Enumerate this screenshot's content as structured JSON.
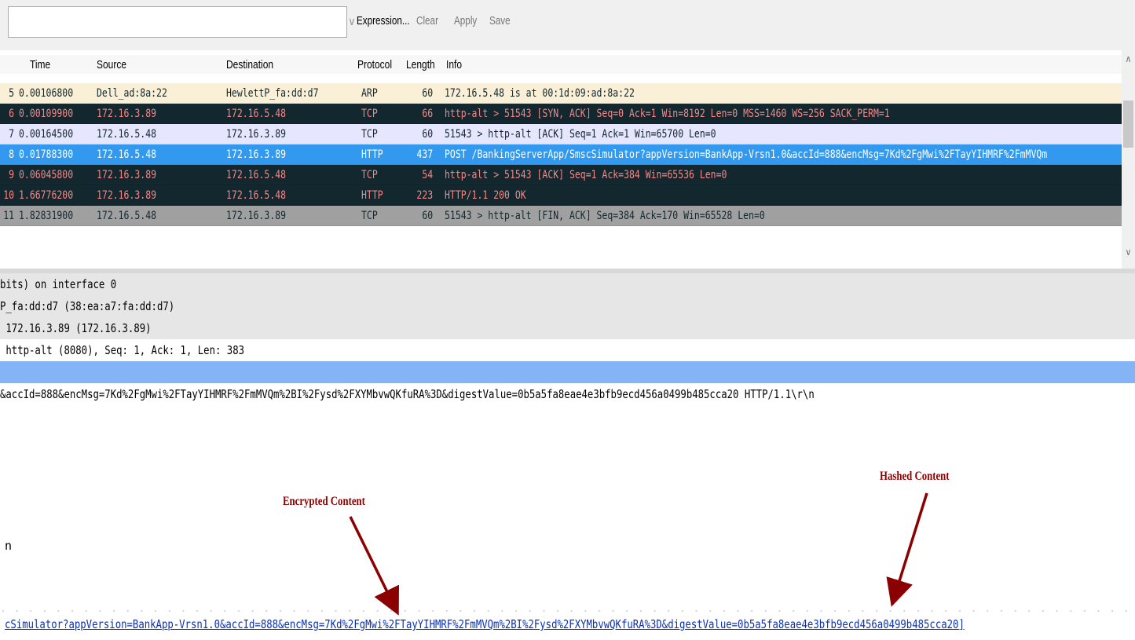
{
  "toolbar": {
    "filter_value": "",
    "expression_label": "Expression...",
    "clear_label": "Clear",
    "apply_label": "Apply",
    "save_label": "Save"
  },
  "packet_list": {
    "headers": {
      "time": "Time",
      "source": "Source",
      "destination": "Destination",
      "protocol": "Protocol",
      "length": "Length",
      "info": "Info"
    },
    "rows": [
      {
        "no": "5",
        "time": "0.00106800",
        "source": "Dell_ad:8a:22",
        "destination": "HewlettP_fa:dd:d7",
        "protocol": "ARP",
        "length": "60",
        "info": "172.16.5.48 is at 00:1d:09:ad:8a:22",
        "bg": "#faf0d7",
        "fg": "#12272e"
      },
      {
        "no": "6",
        "time": "0.00109900",
        "source": "172.16.3.89",
        "destination": "172.16.5.48",
        "protocol": "TCP",
        "length": "66",
        "info": "http-alt > 51543 [SYN, ACK] Seq=0 Ack=1 Win=8192 Len=0 MSS=1460 WS=256 SACK_PERM=1",
        "bg": "#12272e",
        "fg": "#f78787"
      },
      {
        "no": "7",
        "time": "0.00164500",
        "source": "172.16.5.48",
        "destination": "172.16.3.89",
        "protocol": "TCP",
        "length": "60",
        "info": "51543 > http-alt [ACK] Seq=1 Ack=1 Win=65700 Len=0",
        "bg": "#e7e6ff",
        "fg": "#12272e"
      },
      {
        "no": "8",
        "time": "0.01788300",
        "source": "172.16.5.48",
        "destination": "172.16.3.89",
        "protocol": "HTTP",
        "length": "437",
        "info": "POST /BankingServerApp/SmscSimulator?appVersion=BankApp-Vrsn1.0&accId=888&encMsg=7Kd%2FgMwi%2FTayYIHMRF%2FmMVQm",
        "bg": "#3399ee",
        "fg": "#ffffff"
      },
      {
        "no": "9",
        "time": "0.06045800",
        "source": "172.16.3.89",
        "destination": "172.16.5.48",
        "protocol": "TCP",
        "length": "54",
        "info": "http-alt > 51543 [ACK] Seq=1 Ack=384 Win=65536 Len=0",
        "bg": "#12272e",
        "fg": "#f78787"
      },
      {
        "no": "10",
        "time": "1.66776200",
        "source": "172.16.3.89",
        "destination": "172.16.5.48",
        "protocol": "HTTP",
        "length": "223",
        "info": "HTTP/1.1 200 OK",
        "bg": "#12272e",
        "fg": "#f78787"
      },
      {
        "no": "11",
        "time": "1.82831900",
        "source": "172.16.5.48",
        "destination": "172.16.3.89",
        "protocol": "TCP",
        "length": "60",
        "info": "51543 > http-alt [FIN, ACK] Seq=384 Ack=170 Win=65528 Len=0",
        "bg": "#a0a0a0",
        "fg": "#12272e"
      }
    ]
  },
  "details": [
    {
      "text": "bits) on interface 0",
      "style": "grey"
    },
    {
      "text": "P_fa:dd:d7 (38:ea:a7:fa:dd:d7)",
      "style": "grey"
    },
    {
      "text": " 172.16.3.89 (172.16.3.89)",
      "style": "grey"
    },
    {
      "text": " http-alt (8080), Seq: 1, Ack: 1, Len: 383",
      "style": "white"
    },
    {
      "text": "",
      "style": "hl"
    },
    {
      "text": "&accId=888&encMsg=7Kd%2FgMwi%2FTayYIHMRF%2FmMVQm%2BI%2Fysd%2FXYMbvwQKfuRA%3D&digestValue=0b5a5fa8eae4e3bfb9ecd456a0499b485cca20 HTTP/1.1\\r\\n",
      "style": "uri"
    }
  ],
  "annotations": {
    "encrypted_label": "Encrypted Content",
    "hashed_label": "Hashed Content",
    "arrow_color": "#8b0000"
  },
  "lone_text": "n",
  "bottom_uri": "cSimulator?appVersion=BankApp-Vrsn1.0&accId=888&encMsg=7Kd%2FgMwi%2FTayYIHMRF%2FmMVQm%2BI%2Fysd%2FXYMbvwQKfuRA%3D&digestValue=0b5a5fa8eae4e3bfb9ecd456a0499b485cca20]"
}
